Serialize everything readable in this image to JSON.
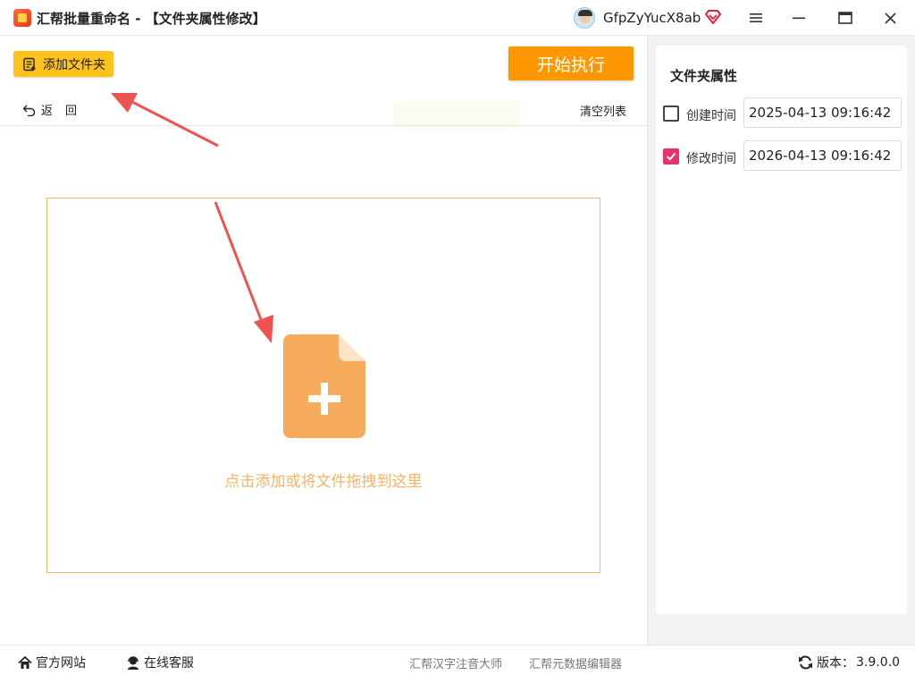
{
  "window": {
    "title": "汇帮批量重命名 - 【文件夹属性修改】",
    "username": "GfpZyYucX8ab"
  },
  "toolbar": {
    "add_folder_label": "添加文件夹",
    "start_label": "开始执行",
    "back_label": "返回",
    "clear_list_label": "清空列表"
  },
  "dropzone": {
    "hint": "点击添加或将文件拖拽到这里"
  },
  "folder_attributes": {
    "title": "文件夹属性",
    "fields": [
      {
        "label": "创建时间",
        "checked": false,
        "value": "2025-04-13 09:16:42"
      },
      {
        "label": "修改时间",
        "checked": true,
        "value": "2026-04-13 09:16:42"
      }
    ]
  },
  "statusbar": {
    "website_label": "官方网站",
    "support_label": "在线客服",
    "link_pinyin": "汇帮汉字注音大师",
    "link_metadata": "汇帮元数据编辑器",
    "version_label": "版本：",
    "version_value": "3.9.0.0"
  },
  "colors": {
    "accent_orange": "#ff9700",
    "add_button_yellow": "#ffc21a",
    "dropzone_border": "#f3b76a",
    "dropzone_icon": "#f7ac5c",
    "checkbox_checked": "#e8336a",
    "annotation_arrow": "#ef5350"
  }
}
